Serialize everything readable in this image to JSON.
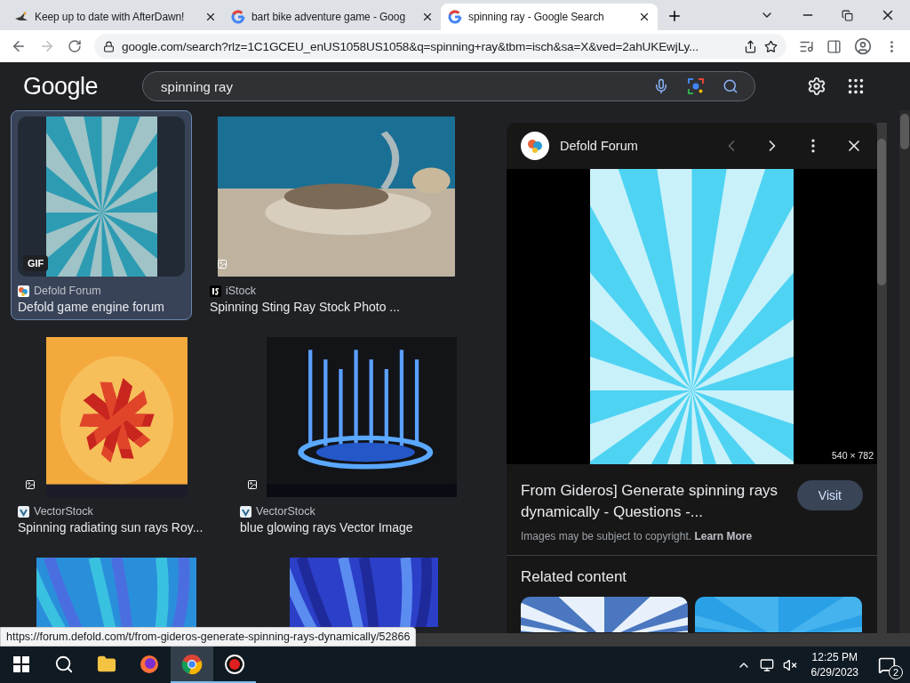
{
  "browser": {
    "tabs": [
      {
        "title": "Keep up to date with AfterDawn!",
        "kind": "bird",
        "selected": false
      },
      {
        "title": "bart bike adventure game - Goog",
        "kind": "google",
        "selected": false
      },
      {
        "title": "spinning ray - Google Search",
        "kind": "google",
        "selected": true
      }
    ],
    "address": "google.com/search?rlz=1C1GCEU_enUS1058US1058&q=spinning+ray&tbm=isch&sa=X&ved=2ahUKEwjLy..."
  },
  "header": {
    "logo": "Google",
    "query": "spinning ray"
  },
  "results": [
    {
      "kind": "defold",
      "source": "Defold Forum",
      "title": "Defold game engine forum",
      "badge": "GIF",
      "selected": true
    },
    {
      "kind": "istock",
      "source": "iStock",
      "title": "Spinning Sting Ray Stock Photo ...",
      "selected": false
    },
    {
      "kind": "vector",
      "source": "VectorStock",
      "title": "Spinning radiating sun rays Roy...",
      "selected": false
    },
    {
      "kind": "vector",
      "source": "VectorStock",
      "title": "blue glowing rays Vector Image",
      "selected": false
    },
    {
      "selected": false
    },
    {
      "selected": false
    }
  ],
  "panel": {
    "source": "Defold Forum",
    "dimensions": "540 × 782",
    "title": "From Gideros] Generate spinning rays dynamically - Questions -...",
    "visit": "Visit",
    "note": "Images may be subject to copyright.",
    "learn_more": "Learn More",
    "related_heading": "Related content"
  },
  "status_url": "https://forum.defold.com/t/from-gideros-generate-spinning-rays-dynamically/52866",
  "taskbar": {
    "apps": [
      {
        "kind": "start",
        "selected": false,
        "running": false
      },
      {
        "kind": "search",
        "selected": false,
        "running": false
      },
      {
        "kind": "explorer",
        "selected": false,
        "running": false
      },
      {
        "kind": "firefox",
        "selected": false,
        "running": false
      },
      {
        "kind": "chrome",
        "selected": true,
        "running": true
      },
      {
        "kind": "recorder",
        "selected": false,
        "running": true
      }
    ],
    "time": "12:25 PM",
    "date": "6/29/2023",
    "notifications": "2"
  }
}
